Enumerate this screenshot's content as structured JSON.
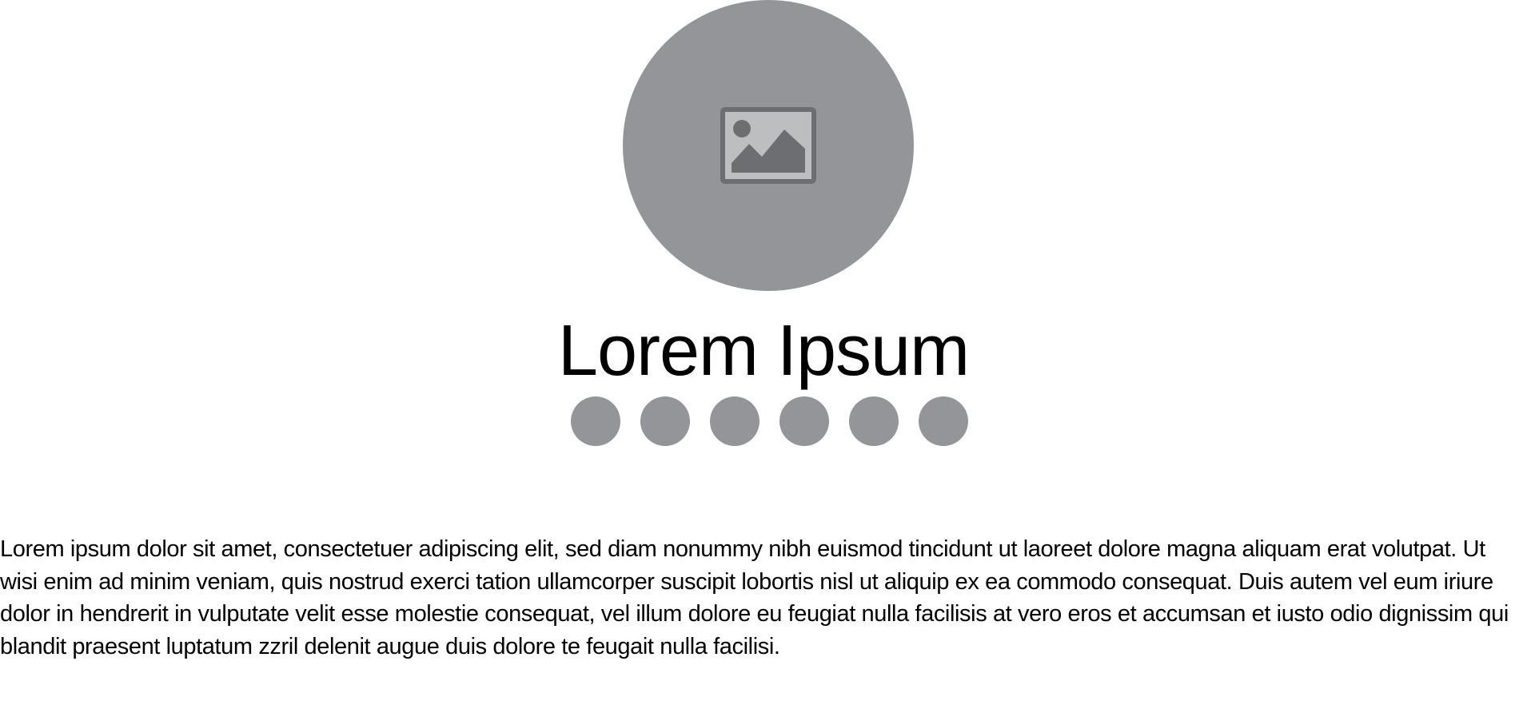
{
  "hero": {
    "image_placeholder_icon": "image-icon",
    "title": "Lorem Ipsum",
    "indicator_count": 6
  },
  "colors": {
    "placeholder_gray": "#939598",
    "icon_frame": "#6d6e71",
    "icon_fill": "#bcbec0",
    "text": "#000000",
    "background": "#ffffff"
  },
  "body": {
    "paragraph": "Lorem ipsum dolor sit amet, consectetuer adipiscing elit, sed diam nonummy nibh euismod tincidunt ut laoreet dolore magna aliquam erat volutpat. Ut wisi enim ad minim veniam, quis nostrud exerci tation ullamcorper suscipit lobortis nisl ut aliquip ex ea commodo consequat. Duis autem vel eum iriure dolor in hendrerit in vulputate velit esse molestie consequat, vel illum dolore eu feugiat nulla facilisis at vero eros et accumsan et iusto odio dignissim qui blandit praesent luptatum zzril delenit augue duis dolore te feugait nulla facilisi."
  }
}
